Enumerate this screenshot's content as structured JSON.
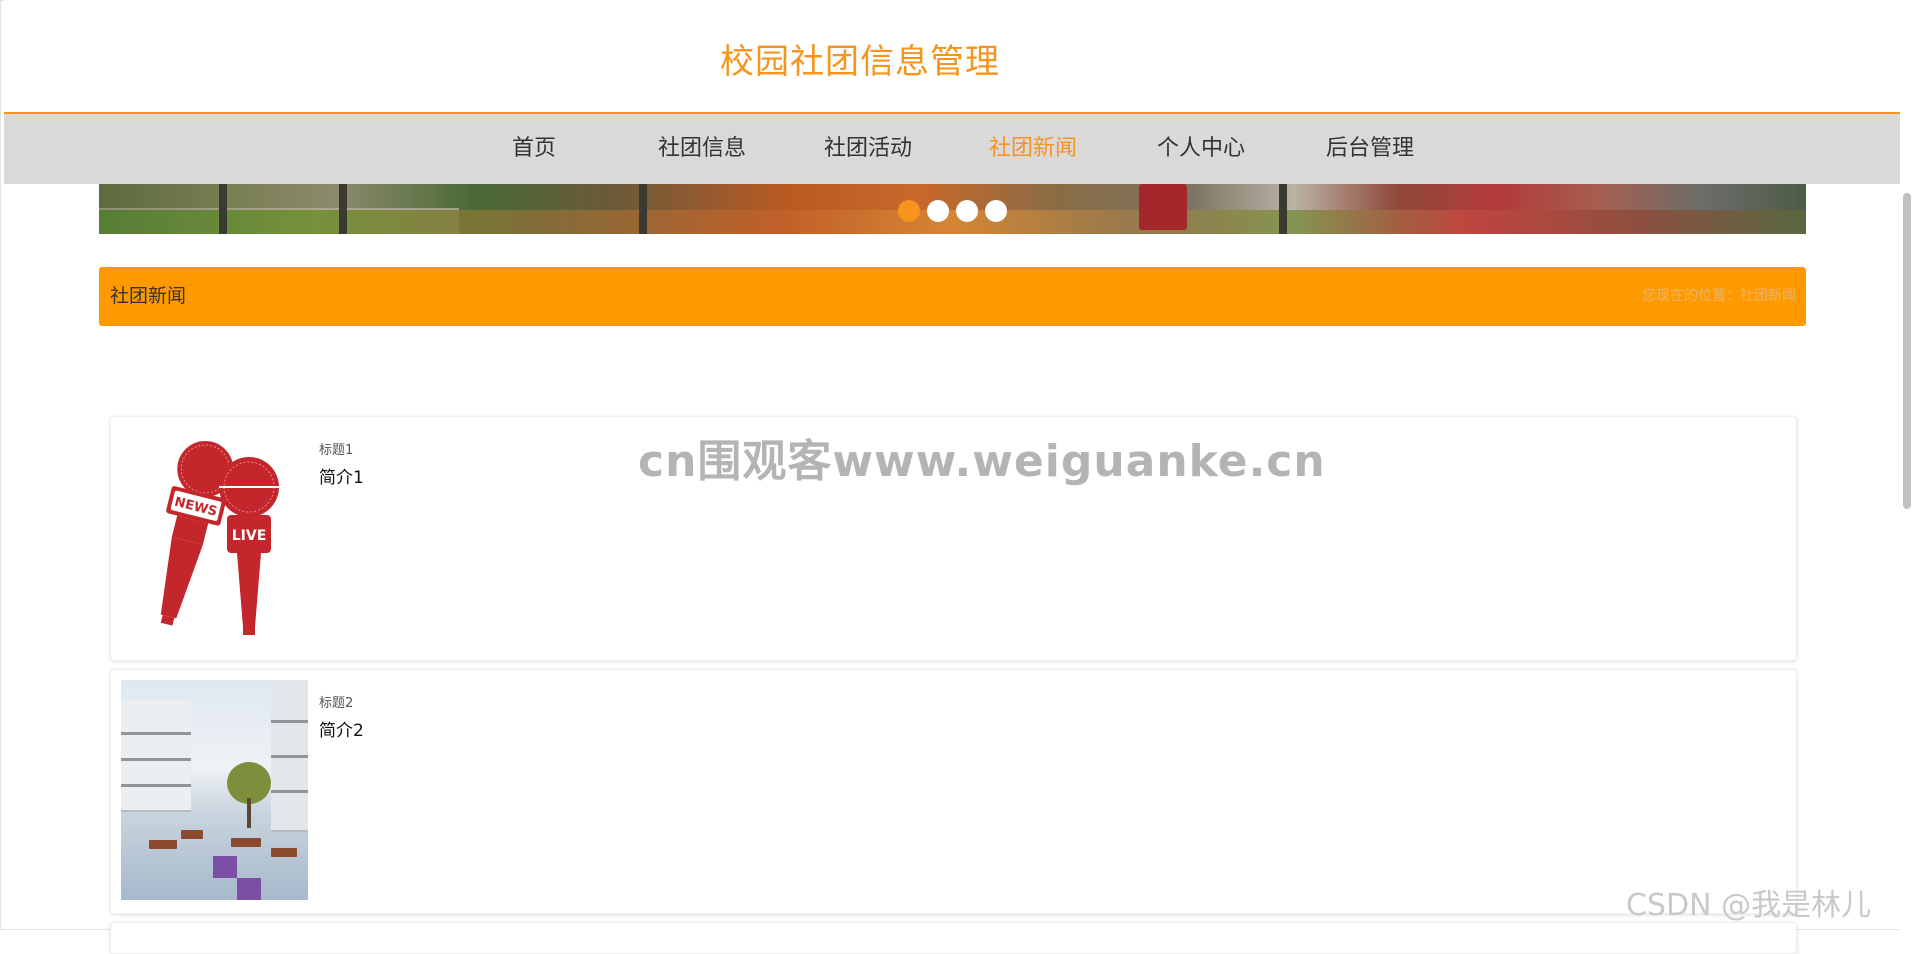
{
  "header": {
    "site_title": "校园社团信息管理"
  },
  "nav": {
    "items": [
      {
        "label": "首页",
        "active": false
      },
      {
        "label": "社团信息",
        "active": false
      },
      {
        "label": "社团活动",
        "active": false
      },
      {
        "label": "社团新闻",
        "active": true
      },
      {
        "label": "个人中心",
        "active": false
      },
      {
        "label": "后台管理",
        "active": false
      }
    ]
  },
  "carousel": {
    "slide_count": 4,
    "active_index": 0
  },
  "section": {
    "title": "社团新闻",
    "breadcrumb": "您现在的位置：社团新闻"
  },
  "news": [
    {
      "title": "标题1",
      "intro": "简介1",
      "thumb_icon": "news-microphone-icon"
    },
    {
      "title": "标题2",
      "intro": "简介2",
      "thumb_icon": "campus-building-photo"
    }
  ],
  "watermarks": {
    "center": "cn围观客www.weiguanke.cn",
    "corner": "CSDN @我是林儿"
  },
  "colors": {
    "accent": "#f7941d",
    "section_bar": "#ff9900",
    "nav_bg": "#d9d9d9",
    "mic_red": "#c4272b"
  }
}
